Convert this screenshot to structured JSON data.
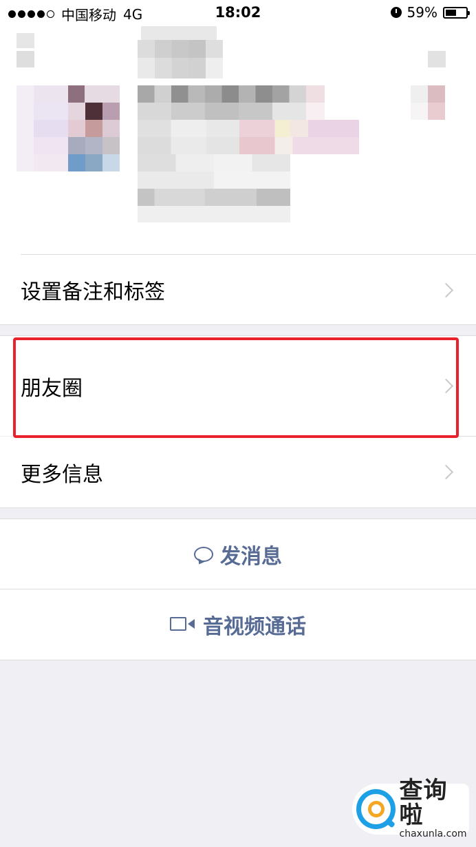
{
  "status_bar": {
    "carrier": "中国移动",
    "network": "4G",
    "time": "18:02",
    "battery_text": "59%",
    "battery_level": 0.59,
    "signal_bars_filled": 4,
    "signal_bars_total": 5
  },
  "menu": {
    "remark_tags_label": "设置备注和标签",
    "moments_label": "朋友圈",
    "more_info_label": "更多信息"
  },
  "actions": {
    "message_label": "发消息",
    "video_call_label": "音视频通话"
  },
  "icons": {
    "chat": "chat-bubble-icon",
    "video": "video-camera-icon",
    "chevron": "chevron-right-icon"
  },
  "colors": {
    "action_text": "#576b95",
    "highlight_border": "#e8212c",
    "background": "#efeff4"
  },
  "watermark": {
    "name": "查询啦",
    "domain": "chaxunla.com"
  }
}
